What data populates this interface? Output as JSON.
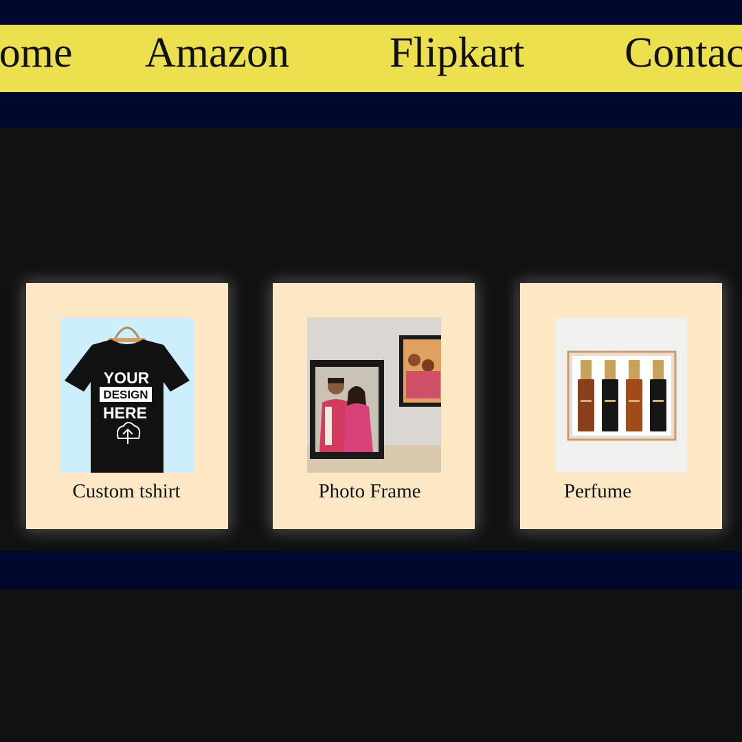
{
  "nav": {
    "home": "Home",
    "amazon": "Amazon",
    "flipkart": "Flipkart",
    "contact": "Contact"
  },
  "products": [
    {
      "label": "Custom tshirt",
      "image_text": {
        "line1": "YOUR",
        "line2": "DESIGN",
        "line3": "HERE"
      }
    },
    {
      "label": "Photo Frame"
    },
    {
      "label": "Perfume"
    }
  ],
  "colors": {
    "page_bg": "#111111",
    "band": "#01082e",
    "navbar": "#ede04e",
    "card_bg": "#fde8c6",
    "text": "#111111"
  }
}
